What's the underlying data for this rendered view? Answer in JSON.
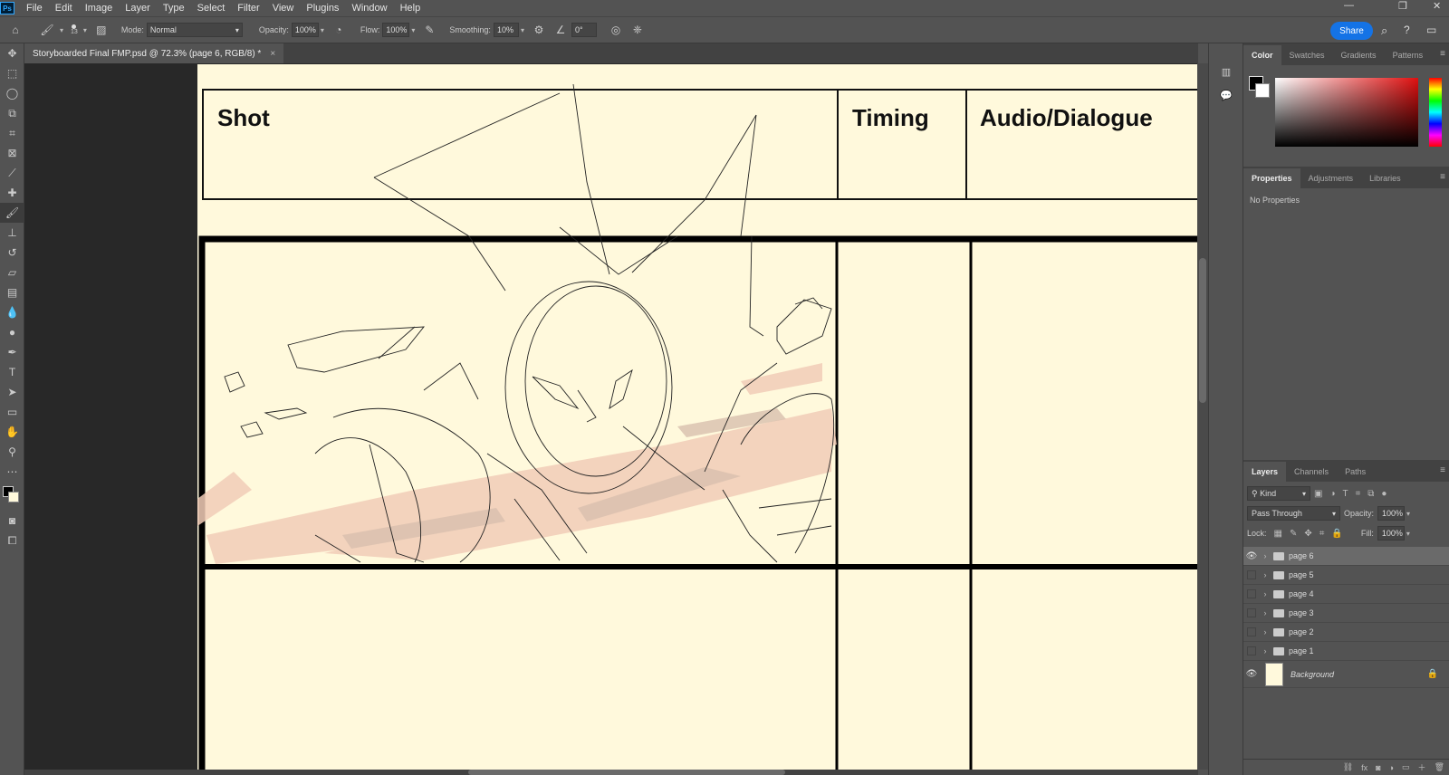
{
  "app": {
    "logo": "Ps"
  },
  "menu": [
    "File",
    "Edit",
    "Image",
    "Layer",
    "Type",
    "Select",
    "Filter",
    "View",
    "Plugins",
    "Window",
    "Help"
  ],
  "options": {
    "brush_size": "13",
    "mode_label": "Mode:",
    "mode_value": "Normal",
    "opacity_label": "Opacity:",
    "opacity_value": "100%",
    "flow_label": "Flow:",
    "flow_value": "100%",
    "smoothing_label": "Smoothing:",
    "smoothing_value": "10%",
    "angle_value": "0°",
    "share_label": "Share"
  },
  "document": {
    "tab_title": "Storyboarded Final FMP.psd @ 72.3% (page 6, RGB/8) *",
    "close": "×"
  },
  "storyboard": {
    "col_shot": "Shot",
    "col_timing": "Timing",
    "col_audio": "Audio/Dialogue"
  },
  "color_panel": {
    "tabs": [
      "Color",
      "Swatches",
      "Gradients",
      "Patterns"
    ]
  },
  "properties_panel": {
    "tabs": [
      "Properties",
      "Adjustments",
      "Libraries"
    ],
    "empty_text": "No Properties"
  },
  "layers_panel": {
    "tabs": [
      "Layers",
      "Channels",
      "Paths"
    ],
    "filter_value": "Kind",
    "blend_value": "Pass Through",
    "opacity_label": "Opacity:",
    "opacity_value": "100%",
    "lock_label": "Lock:",
    "fill_label": "Fill:",
    "fill_value": "100%",
    "layers": [
      {
        "name": "page 6",
        "visible": true,
        "selected": true
      },
      {
        "name": "page 5",
        "visible": false
      },
      {
        "name": "page 4",
        "visible": false
      },
      {
        "name": "page 3",
        "visible": false
      },
      {
        "name": "page 2",
        "visible": false
      },
      {
        "name": "page 1",
        "visible": false
      }
    ],
    "background_name": "Background"
  },
  "colors": {
    "canvas": "#fff9dc",
    "share": "#1473e6",
    "sketch_tint": "#f2cdb8"
  }
}
